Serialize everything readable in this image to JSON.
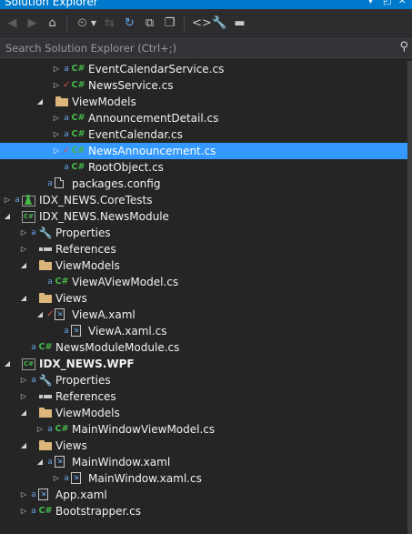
{
  "window": {
    "title": "Solution Explorer",
    "title_buttons": [
      "▾",
      "◰",
      "✕"
    ]
  },
  "toolbar": {
    "buttons": [
      {
        "name": "back-button",
        "glyph": "◀"
      },
      {
        "name": "forward-button",
        "glyph": "▶"
      },
      {
        "name": "home-button",
        "glyph": "⌂"
      },
      {
        "name": "pending-changes-filter-button",
        "glyph": "⏲"
      },
      {
        "name": "sync-with-active-document-button",
        "glyph": "⇆"
      },
      {
        "name": "refresh-button",
        "glyph": "↻"
      },
      {
        "name": "collapse-all-button",
        "glyph": "⧉"
      },
      {
        "name": "show-all-files-button",
        "glyph": "❐"
      },
      {
        "name": "view-code-button",
        "glyph": "<>"
      },
      {
        "name": "properties-button",
        "glyph": "🔧"
      },
      {
        "name": "preview-button",
        "glyph": "▬"
      }
    ]
  },
  "search": {
    "placeholder": "Search Solution Explorer (Ctrl+;)"
  },
  "tree": [
    {
      "label": "EventCalendarService.cs",
      "icon": "csharp-file-icon",
      "overlay": "lock",
      "expander": "collapsed",
      "level": 3,
      "selected": false,
      "bold": false
    },
    {
      "label": "NewsService.cs",
      "icon": "csharp-file-icon",
      "overlay": "check",
      "expander": "collapsed",
      "level": 3,
      "selected": false,
      "bold": false
    },
    {
      "label": "ViewModels",
      "icon": "folder-icon",
      "overlay": "",
      "expander": "expanded",
      "level": 2,
      "selected": false,
      "bold": false
    },
    {
      "label": "AnnouncementDetail.cs",
      "icon": "csharp-file-icon",
      "overlay": "lock",
      "expander": "collapsed",
      "level": 3,
      "selected": false,
      "bold": false
    },
    {
      "label": "EventCalendar.cs",
      "icon": "csharp-file-icon",
      "overlay": "lock",
      "expander": "collapsed",
      "level": 3,
      "selected": false,
      "bold": false
    },
    {
      "label": "NewsAnnouncement.cs",
      "icon": "csharp-file-icon",
      "overlay": "check",
      "expander": "collapsed",
      "level": 3,
      "selected": true,
      "bold": false
    },
    {
      "label": "RootObject.cs",
      "icon": "csharp-file-icon",
      "overlay": "lock",
      "expander": "none",
      "level": 3,
      "selected": false,
      "bold": false
    },
    {
      "label": "packages.config",
      "icon": "config-file-icon",
      "overlay": "lock",
      "expander": "none",
      "level": 2,
      "selected": false,
      "bold": false
    },
    {
      "label": "IDX_NEWS.CoreTests",
      "icon": "test-project-icon",
      "overlay": "lock",
      "expander": "collapsed",
      "level": 0,
      "selected": false,
      "bold": false
    },
    {
      "label": "IDX_NEWS.NewsModule",
      "icon": "csharp-project-icon",
      "overlay": "",
      "expander": "expanded",
      "level": 0,
      "selected": false,
      "bold": false
    },
    {
      "label": "Properties",
      "icon": "wrench-icon",
      "overlay": "lock",
      "expander": "collapsed",
      "level": 1,
      "selected": false,
      "bold": false
    },
    {
      "label": "References",
      "icon": "references-icon",
      "overlay": "",
      "expander": "collapsed",
      "level": 1,
      "selected": false,
      "bold": false
    },
    {
      "label": "ViewModels",
      "icon": "folder-icon",
      "overlay": "",
      "expander": "expanded",
      "level": 1,
      "selected": false,
      "bold": false
    },
    {
      "label": "ViewAViewModel.cs",
      "icon": "csharp-file-icon",
      "overlay": "lock",
      "expander": "none",
      "level": 2,
      "selected": false,
      "bold": false
    },
    {
      "label": "Views",
      "icon": "folder-icon",
      "overlay": "",
      "expander": "expanded",
      "level": 1,
      "selected": false,
      "bold": false
    },
    {
      "label": "ViewA.xaml",
      "icon": "xaml-file-icon",
      "overlay": "check",
      "expander": "expanded",
      "level": 2,
      "selected": false,
      "bold": false
    },
    {
      "label": "ViewA.xaml.cs",
      "icon": "xaml-file-icon",
      "overlay": "lock",
      "expander": "none",
      "level": 3,
      "selected": false,
      "bold": false
    },
    {
      "label": "NewsModuleModule.cs",
      "icon": "csharp-file-icon",
      "overlay": "lock",
      "expander": "none",
      "level": 1,
      "selected": false,
      "bold": false
    },
    {
      "label": "IDX_NEWS.WPF",
      "icon": "csharp-project-icon",
      "overlay": "",
      "expander": "expanded",
      "level": 0,
      "selected": false,
      "bold": true
    },
    {
      "label": "Properties",
      "icon": "wrench-icon",
      "overlay": "lock",
      "expander": "collapsed",
      "level": 1,
      "selected": false,
      "bold": false
    },
    {
      "label": "References",
      "icon": "references-icon",
      "overlay": "",
      "expander": "collapsed",
      "level": 1,
      "selected": false,
      "bold": false
    },
    {
      "label": "ViewModels",
      "icon": "folder-icon",
      "overlay": "",
      "expander": "expanded",
      "level": 1,
      "selected": false,
      "bold": false
    },
    {
      "label": "MainWindowViewModel.cs",
      "icon": "csharp-file-icon",
      "overlay": "lock",
      "expander": "collapsed",
      "level": 2,
      "selected": false,
      "bold": false
    },
    {
      "label": "Views",
      "icon": "folder-icon",
      "overlay": "",
      "expander": "expanded",
      "level": 1,
      "selected": false,
      "bold": false
    },
    {
      "label": "MainWindow.xaml",
      "icon": "xaml-file-icon",
      "overlay": "lock",
      "expander": "expanded",
      "level": 2,
      "selected": false,
      "bold": false
    },
    {
      "label": "MainWindow.xaml.cs",
      "icon": "xaml-file-icon",
      "overlay": "lock",
      "expander": "collapsed",
      "level": 3,
      "selected": false,
      "bold": false
    },
    {
      "label": "App.xaml",
      "icon": "xaml-file-icon",
      "overlay": "lock",
      "expander": "collapsed",
      "level": 1,
      "selected": false,
      "bold": false
    },
    {
      "label": "Bootstrapper.cs",
      "icon": "csharp-file-icon",
      "overlay": "lock",
      "expander": "collapsed",
      "level": 1,
      "selected": false,
      "bold": false
    }
  ]
}
